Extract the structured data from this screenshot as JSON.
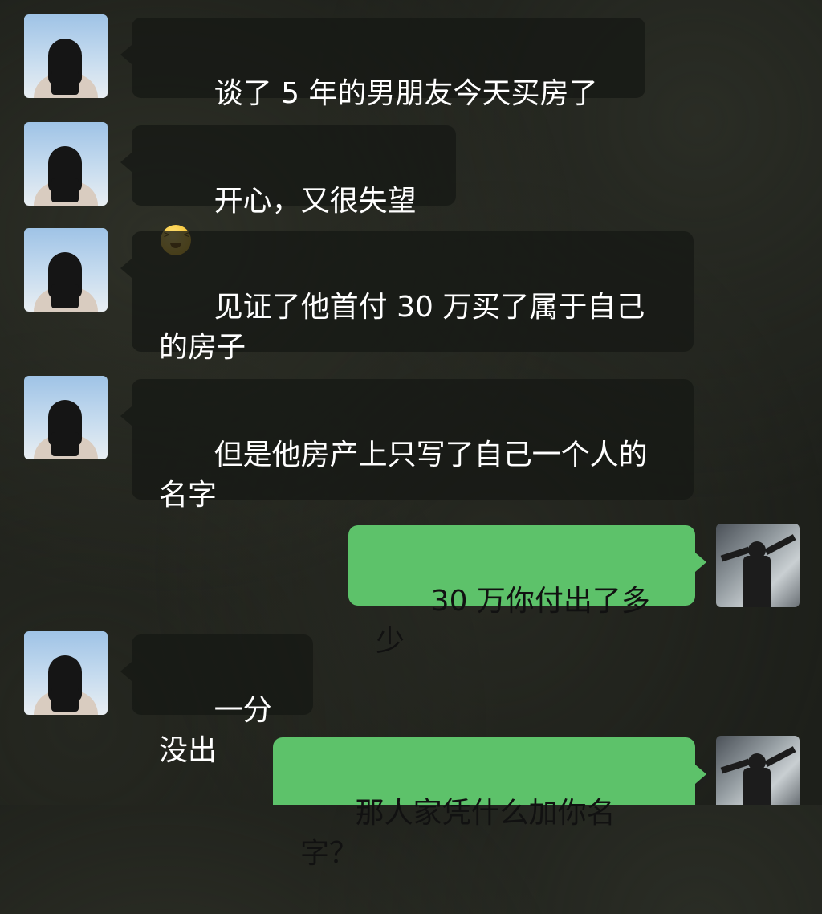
{
  "messages": [
    {
      "sender": "other",
      "text": "谈了 5 年的男朋友今天买房了"
    },
    {
      "sender": "other",
      "text": "开心，又很失望",
      "emoji": "grimacing-face-emoji"
    },
    {
      "sender": "other",
      "text": "见证了他首付 30 万买了属于自己\n的房子"
    },
    {
      "sender": "other",
      "text": "但是他房产上只写了自己一个人的\n名字"
    },
    {
      "sender": "self",
      "text": "30 万你付出了多少"
    },
    {
      "sender": "other",
      "text": "一分没出"
    },
    {
      "sender": "self",
      "text": "那人家凭什么加你名字？"
    }
  ],
  "avatars": {
    "other": "girl-back-avatar",
    "self": "man-arms-raised-avatar"
  },
  "colors": {
    "incoming_bubble": "#16181499",
    "outgoing_bubble": "#5dc26a",
    "background": "#1d1f1a"
  }
}
